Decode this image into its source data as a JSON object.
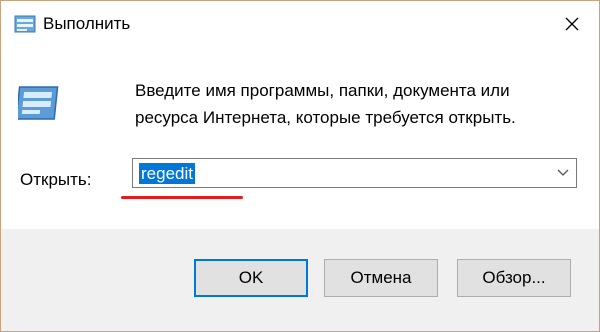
{
  "window": {
    "title": "Выполнить",
    "title_icon": "run-dialog-icon",
    "close_icon": "close-icon"
  },
  "dialog": {
    "icon": "run-program-icon",
    "description": "Введите имя программы, папки, документа или ресурса Интернета, которые требуется открыть.",
    "open_label": "Открыть:",
    "open_value": "regedit",
    "dropdown_icon": "chevron-down-icon"
  },
  "buttons": {
    "ok": "OK",
    "cancel": "Отмена",
    "browse": "Обзор..."
  },
  "colors": {
    "selection": "#0078d7",
    "annotation_underline": "#e01e1e",
    "footer_bg": "#f0f0f0",
    "border": "#c8a27a"
  }
}
